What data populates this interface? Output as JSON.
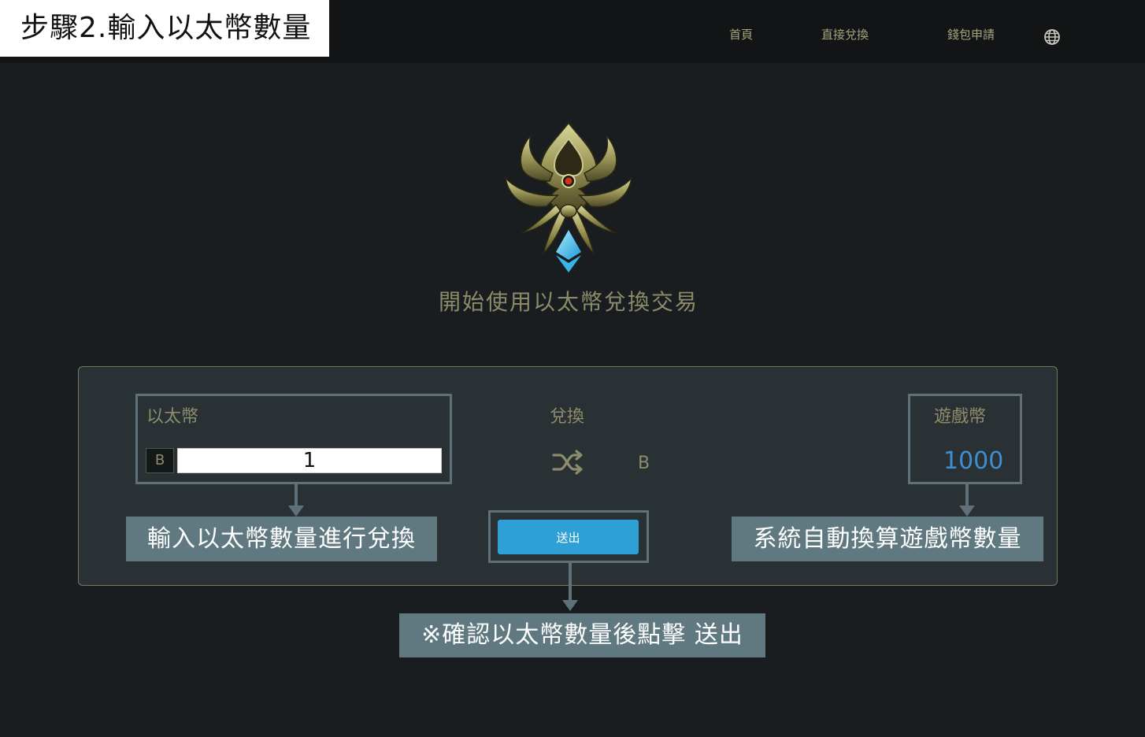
{
  "banner": {
    "text": "步驟2.輸入以太幣數量"
  },
  "nav": {
    "items": [
      "首頁",
      "直接兌換",
      "錢包申請"
    ]
  },
  "hero": {
    "title": "開始使用以太幣兌換交易"
  },
  "exchange": {
    "eth_label": "以太幣",
    "eth_currency_tag": "B",
    "eth_value": "1",
    "center_label": "兌換",
    "center_currency": "B",
    "game_label": "遊戲幣",
    "game_value": "1000",
    "submit_label": "送出"
  },
  "annotations": {
    "input_note": "輸入以太幣數量進行兌換",
    "auto_note": "系統自動換算遊戲幣數量",
    "confirm_note": "※確認以太幣數量後點擊 送出"
  },
  "colors": {
    "accent_blue": "#2ea0d6",
    "value_blue": "#3f8fd0",
    "gold_text": "#8c8c6c",
    "callout_bg": "#607880"
  }
}
